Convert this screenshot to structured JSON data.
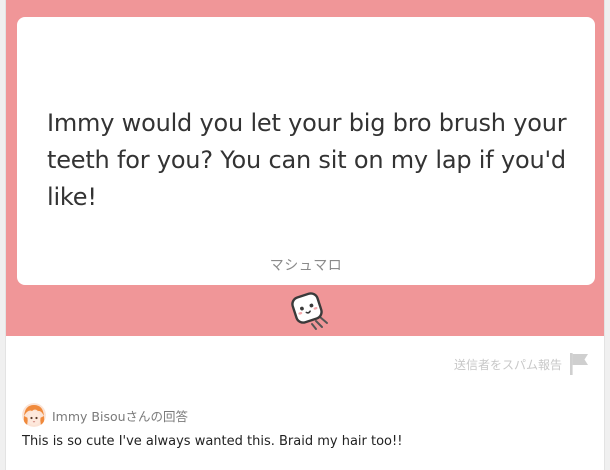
{
  "question": {
    "text": "Immy would you let your big bro brush your teeth for you? You can sit on my lap if you'd like!",
    "brand": "マシュマロ"
  },
  "report": {
    "label": "送信者をスパム報告"
  },
  "answer": {
    "header": "Immy Bisouさんの回答",
    "text": "This is so cute I've always wanted this. Braid my hair too!!"
  },
  "colors": {
    "band": "#f09698",
    "card": "#ffffff"
  },
  "icons": {
    "marshmallow": "marshmallow-icon",
    "report": "flag-icon",
    "avatar": "avatar"
  }
}
